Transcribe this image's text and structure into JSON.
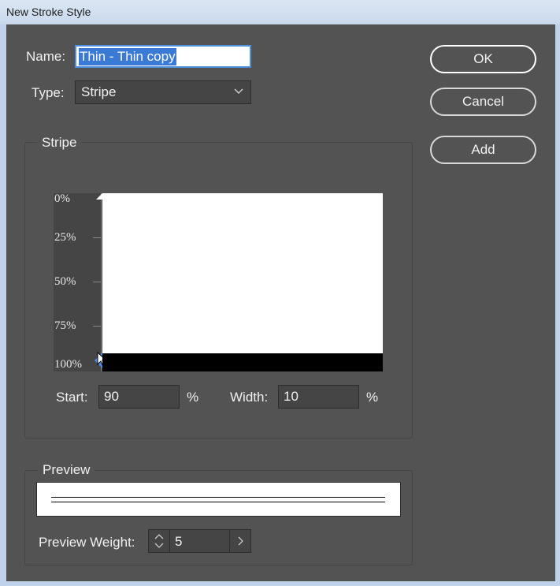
{
  "window": {
    "title": "New Stroke Style"
  },
  "form": {
    "name_label": "Name:",
    "name_value": "Thin - Thin copy",
    "type_label": "Type:",
    "type_value": "Stripe"
  },
  "buttons": {
    "ok": "OK",
    "cancel": "Cancel",
    "add": "Add"
  },
  "stripe_group": {
    "title": "Stripe",
    "ruler_labels": [
      "0%",
      "25%",
      "50%",
      "75%",
      "100%"
    ],
    "stripes": [
      {
        "start": 90,
        "width": 10
      }
    ],
    "start_label": "Start:",
    "start_value": "90",
    "start_unit": "%",
    "width_label": "Width:",
    "width_value": "10",
    "width_unit": "%"
  },
  "preview_group": {
    "title": "Preview",
    "weight_label": "Preview Weight:",
    "weight_value": "5"
  },
  "colors": {
    "background": "#535353",
    "field": "#454545",
    "selection": "#3a79d6",
    "stripe": "#000000"
  },
  "icons": [
    "chevron-down-icon",
    "stepper-arrows-icon",
    "chevron-right-icon",
    "stripe-handle-icon",
    "mouse-cursor-icon"
  ]
}
